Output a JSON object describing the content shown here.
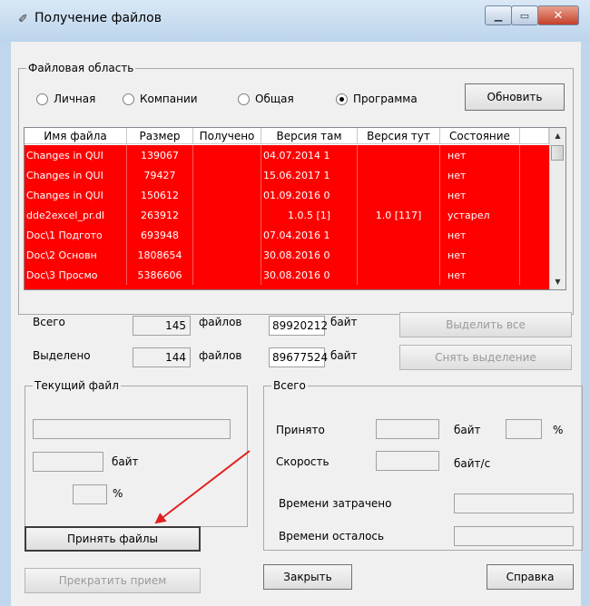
{
  "window": {
    "title": "Получение файлов",
    "title_icon": "feather-icon"
  },
  "area": {
    "legend": "Файловая область",
    "radios": [
      {
        "label": "Личная",
        "checked": false
      },
      {
        "label": "Компании",
        "checked": false
      },
      {
        "label": "Общая",
        "checked": false
      },
      {
        "label": "Программа",
        "checked": true
      }
    ],
    "refresh_label": "Обновить"
  },
  "table": {
    "columns": [
      "Имя файла",
      "Размер",
      "Получено",
      "Версия там",
      "Версия тут",
      "Состояние"
    ],
    "rows": [
      [
        "Changes in QUI",
        "139067",
        "",
        "04.07.2014 1",
        "",
        "нет"
      ],
      [
        "Changes in QUI",
        "79427",
        "",
        "15.06.2017 1",
        "",
        "нет"
      ],
      [
        "Changes in QUI",
        "150612",
        "",
        "01.09.2016 0",
        "",
        "нет"
      ],
      [
        "dde2excel_pr.dl",
        "263912",
        "",
        "1.0.5 [1]",
        "1.0 [117]",
        "устарел"
      ],
      [
        "Doc\\1 Подгото",
        "693948",
        "",
        "07.04.2016 1",
        "",
        "нет"
      ],
      [
        "Doc\\2 Основн",
        "1808654",
        "",
        "30.08.2016 0",
        "",
        "нет"
      ],
      [
        "Doc\\3 Просмо",
        "5386606",
        "",
        "30.08.2016 0",
        "",
        "нет"
      ]
    ],
    "row_color": "#ff0000"
  },
  "totals": {
    "total_label": "Всего",
    "total_count": "145",
    "files_label": "файлов",
    "total_bytes": "89920212",
    "bytes_label": "байт",
    "select_all_label": "Выделить все",
    "selected_label": "Выделено",
    "selected_count": "144",
    "selected_bytes": "89677524",
    "deselect_label": "Снять выделение"
  },
  "current": {
    "legend": "Текущий файл",
    "bytes_label": "байт",
    "percent_label": "%"
  },
  "summary": {
    "legend": "Всего",
    "received_label": "Принято",
    "bytes_label": "байт",
    "percent_label": "%",
    "speed_label": "Скорость",
    "speed_unit": "байт/с",
    "elapsed_label": "Времени затрачено",
    "remaining_label": "Времени осталось"
  },
  "buttons": {
    "accept": "Принять файлы",
    "stop": "Прекратить прием",
    "close": "Закрыть",
    "help": "Справка"
  },
  "annotation": {
    "arrow_color": "#e02020"
  }
}
